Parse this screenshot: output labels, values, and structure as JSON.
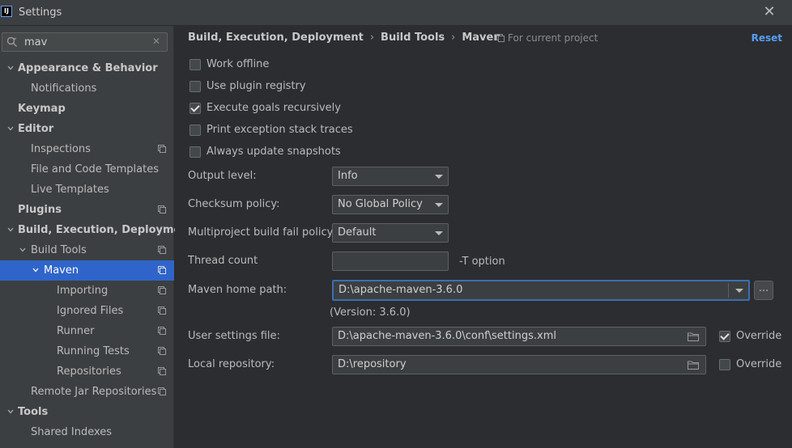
{
  "window": {
    "title": "Settings",
    "app_icon_text": "IJ"
  },
  "search": {
    "value": "mav",
    "placeholder": ""
  },
  "sidebar": {
    "items": [
      {
        "label": "Appearance & Behavior"
      },
      {
        "label": "Notifications"
      },
      {
        "label": "Keymap"
      },
      {
        "label": "Editor"
      },
      {
        "label": "Inspections"
      },
      {
        "label": "File and Code Templates"
      },
      {
        "label": "Live Templates"
      },
      {
        "label": "Plugins"
      },
      {
        "label": "Build, Execution, Deployment"
      },
      {
        "label": "Build Tools"
      },
      {
        "label": "Maven"
      },
      {
        "label": "Importing"
      },
      {
        "label": "Ignored Files"
      },
      {
        "label": "Runner"
      },
      {
        "label": "Running Tests"
      },
      {
        "label": "Repositories"
      },
      {
        "label": "Remote Jar Repositories"
      },
      {
        "label": "Tools"
      },
      {
        "label": "Shared Indexes"
      }
    ]
  },
  "breadcrumb": {
    "part1": "Build, Execution, Deployment",
    "part2": "Build Tools",
    "part3": "Maven",
    "separator": "›"
  },
  "header": {
    "for_project": "For current project",
    "reset": "Reset"
  },
  "checkboxes": {
    "work_offline": {
      "label": "Work offline",
      "checked": false
    },
    "use_plugin_registry": {
      "label": "Use plugin registry",
      "checked": false
    },
    "execute_goals_recursively": {
      "label": "Execute goals recursively",
      "checked": true
    },
    "print_exception_stack_traces": {
      "label": "Print exception stack traces",
      "checked": false
    },
    "always_update_snapshots": {
      "label": "Always update snapshots",
      "checked": false
    }
  },
  "fields": {
    "output_level": {
      "label": "Output level:",
      "value": "Info"
    },
    "checksum_policy": {
      "label": "Checksum policy:",
      "value": "No Global Policy"
    },
    "multiproject_fail_policy": {
      "label": "Multiproject build fail policy:",
      "value": "Default"
    },
    "thread_count": {
      "label": "Thread count",
      "value": "",
      "hint": "-T option"
    },
    "maven_home": {
      "label": "Maven home path:",
      "value": "D:\\apache-maven-3.6.0",
      "version": "(Version: 3.6.0)",
      "browse": "..."
    },
    "user_settings": {
      "label": "User settings file:",
      "value": "D:\\apache-maven-3.6.0\\conf\\settings.xml",
      "override_label": "Override",
      "override": true
    },
    "local_repository": {
      "label": "Local repository:",
      "value": "D:\\repository",
      "override_label": "Override",
      "override": false
    }
  },
  "colors": {
    "accent": "#2f65ca",
    "link": "#589df6",
    "background": "#2b2d30",
    "sidebar": "#3c3f41"
  }
}
